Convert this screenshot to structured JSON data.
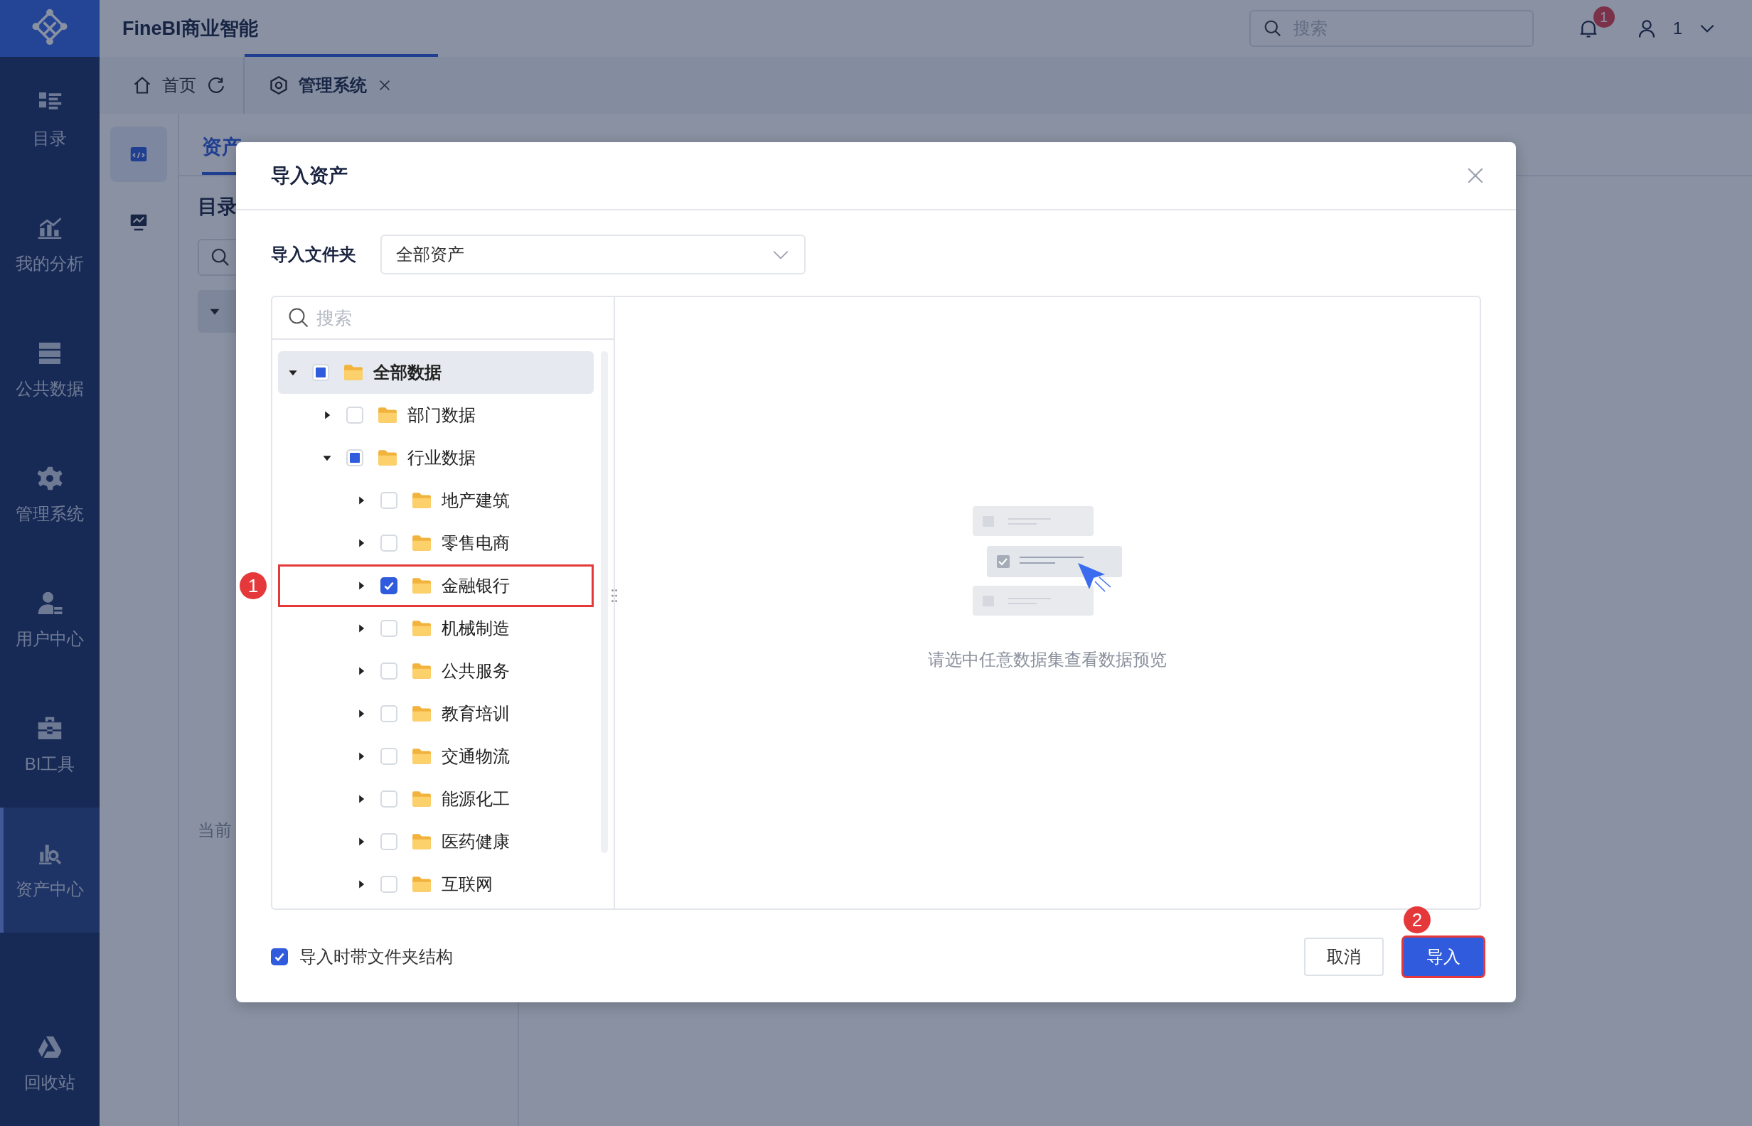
{
  "app": {
    "title": "FineBI商业智能",
    "search_placeholder": "搜索",
    "notification_count": "1",
    "user": "1"
  },
  "sidebar": {
    "items": [
      {
        "label": "目录",
        "selected": false
      },
      {
        "label": "我的分析",
        "selected": false
      },
      {
        "label": "公共数据",
        "selected": false
      },
      {
        "label": "管理系统",
        "selected": false
      },
      {
        "label": "用户中心",
        "selected": false
      },
      {
        "label": "BI工具",
        "selected": false
      },
      {
        "label": "资产中心",
        "selected": true
      }
    ],
    "bottom": {
      "label": "回收站"
    }
  },
  "tabs": [
    {
      "label": "首页",
      "selected": false
    },
    {
      "label": "管理系统",
      "selected": true
    }
  ],
  "subnav": [
    {
      "selected": true
    },
    {
      "selected": false
    }
  ],
  "page": {
    "tab": {
      "label": "资产",
      "selected": true
    },
    "heading": "目录",
    "footer_text": "当前"
  },
  "dialog": {
    "title": "导入资产",
    "folder_label": "导入文件夹",
    "folder_value": "全部资产",
    "search_placeholder": "搜索",
    "tree": [
      {
        "label": "全部数据",
        "checked": false,
        "partial": true,
        "expanded": true,
        "selected": true,
        "highlighted": false,
        "children": [
          {
            "label": "部门数据",
            "checked": false,
            "partial": false,
            "expanded": false,
            "selected": false,
            "highlighted": false
          },
          {
            "label": "行业数据",
            "checked": false,
            "partial": true,
            "expanded": true,
            "selected": false,
            "highlighted": false,
            "children": [
              {
                "label": "地产建筑",
                "checked": false,
                "partial": false,
                "expanded": false,
                "selected": false,
                "highlighted": false
              },
              {
                "label": "零售电商",
                "checked": false,
                "partial": false,
                "expanded": false,
                "selected": false,
                "highlighted": false
              },
              {
                "label": "金融银行",
                "checked": true,
                "partial": false,
                "expanded": false,
                "selected": false,
                "highlighted": true,
                "marker": "1"
              },
              {
                "label": "机械制造",
                "checked": false,
                "partial": false,
                "expanded": false,
                "selected": false,
                "highlighted": false
              },
              {
                "label": "公共服务",
                "checked": false,
                "partial": false,
                "expanded": false,
                "selected": false,
                "highlighted": false
              },
              {
                "label": "教育培训",
                "checked": false,
                "partial": false,
                "expanded": false,
                "selected": false,
                "highlighted": false
              },
              {
                "label": "交通物流",
                "checked": false,
                "partial": false,
                "expanded": false,
                "selected": false,
                "highlighted": false
              },
              {
                "label": "能源化工",
                "checked": false,
                "partial": false,
                "expanded": false,
                "selected": false,
                "highlighted": false
              },
              {
                "label": "医药健康",
                "checked": false,
                "partial": false,
                "expanded": false,
                "selected": false,
                "highlighted": false
              },
              {
                "label": "互联网",
                "checked": false,
                "partial": false,
                "expanded": false,
                "selected": false,
                "highlighted": false
              }
            ]
          }
        ]
      }
    ],
    "empty_text": "请选中任意数据集查看数据预览",
    "keep_structure": {
      "label": "导入时带文件夹结构",
      "checked": true
    },
    "buttons": [
      {
        "label": "取消",
        "kind": "secondary",
        "highlighted": false
      },
      {
        "label": "导入",
        "kind": "primary",
        "highlighted": true,
        "marker": "2"
      }
    ]
  }
}
